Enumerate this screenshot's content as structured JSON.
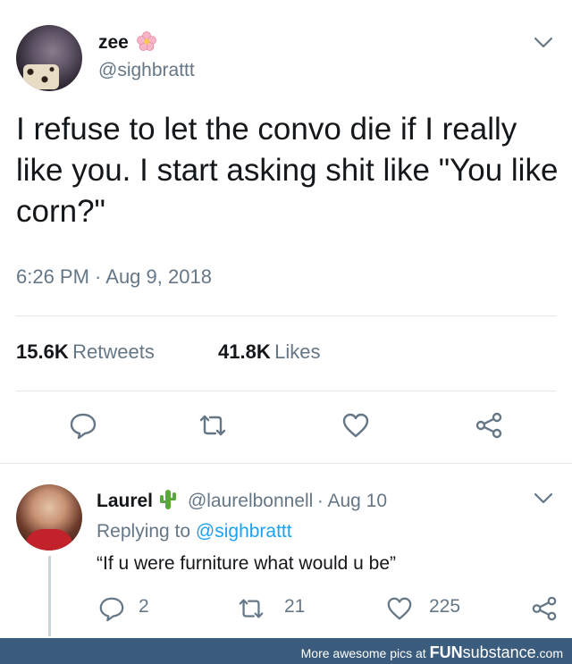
{
  "tweet": {
    "author_name": "zee",
    "author_emoji": "flower-emoji",
    "author_handle": "@sighbrattt",
    "text": "I refuse to let the convo die if I really like you. I start asking shit like \"You like corn?\"",
    "timestamp": "6:26 PM · Aug 9, 2018",
    "retweets_count": "15.6K",
    "retweets_label": "Retweets",
    "likes_count": "41.8K",
    "likes_label": "Likes",
    "actions": [
      "reply-icon",
      "retweet-icon",
      "like-icon",
      "share-icon"
    ]
  },
  "reply": {
    "author_name": "Laurel",
    "author_emoji": "cactus-emoji",
    "author_handle": "@laurelbonnell",
    "date": "· Aug 10",
    "replying_prefix": "Replying to",
    "replying_handle": "@sighbrattt",
    "text": "“If u were furniture what would u be”",
    "reply_count": "2",
    "retweet_count": "21",
    "like_count": "225"
  },
  "footer": {
    "prefix": "More awesome pics at",
    "brand_bold": "FUN",
    "brand_rest": "substance",
    "suffix": ".com"
  },
  "colors": {
    "text": "#14171a",
    "secondary": "#657786",
    "link": "#1da1f2",
    "icon": "#657786",
    "divider": "#e1e8ed",
    "footer_bg": "#3b5c7c"
  }
}
